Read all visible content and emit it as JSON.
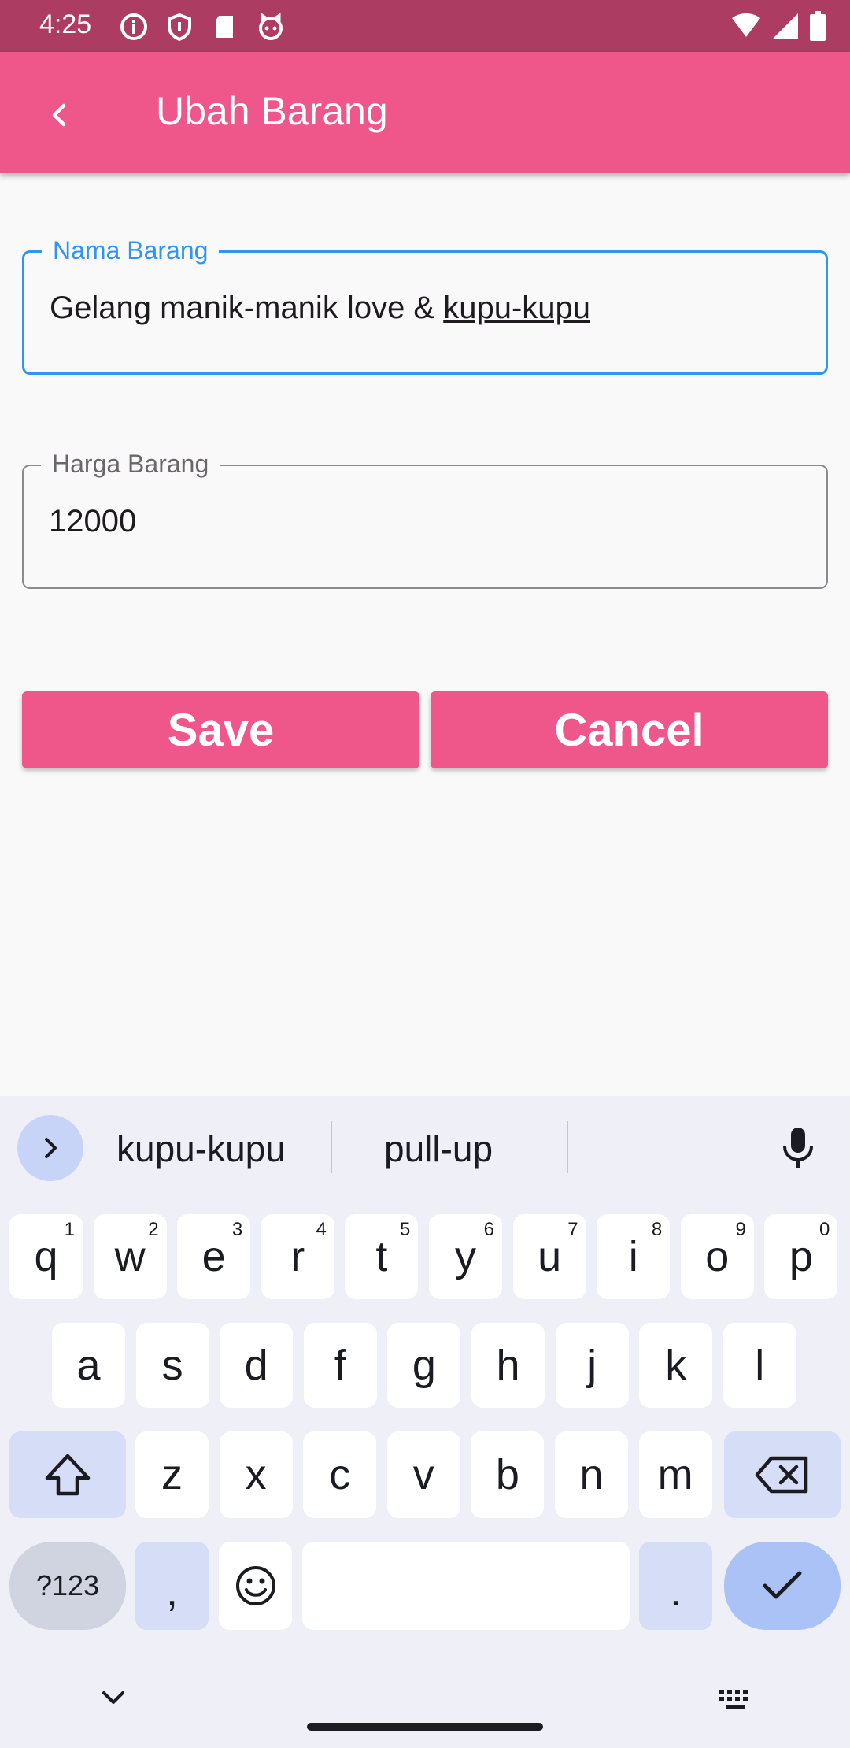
{
  "status_bar": {
    "time": "4:25",
    "left_icons": [
      "info-icon",
      "shield-icon",
      "sd-card-icon",
      "cat-face-icon"
    ],
    "right_icons": [
      "wifi-icon",
      "signal-icon",
      "battery-icon"
    ]
  },
  "app_bar": {
    "title": "Ubah Barang",
    "back_icon": "back-chevron-icon"
  },
  "form": {
    "name_field": {
      "label": "Nama Barang",
      "value_prefix": "Gelang manik-manik love & ",
      "value_underlined": "kupu-kupu"
    },
    "price_field": {
      "label": "Harga Barang",
      "value": "12000"
    },
    "save_label": "Save",
    "cancel_label": "Cancel"
  },
  "colors": {
    "app_bar": "#ef5689",
    "status_bar": "#ad3c63",
    "focus": "#2f95f0",
    "button": "#ef5689"
  },
  "keyboard": {
    "suggestions": [
      "kupu-kupu",
      "pull-up",
      ""
    ],
    "row1": [
      {
        "k": "q",
        "h": "1"
      },
      {
        "k": "w",
        "h": "2"
      },
      {
        "k": "e",
        "h": "3"
      },
      {
        "k": "r",
        "h": "4"
      },
      {
        "k": "t",
        "h": "5"
      },
      {
        "k": "y",
        "h": "6"
      },
      {
        "k": "u",
        "h": "7"
      },
      {
        "k": "i",
        "h": "8"
      },
      {
        "k": "o",
        "h": "9"
      },
      {
        "k": "p",
        "h": "0"
      }
    ],
    "row2": [
      "a",
      "s",
      "d",
      "f",
      "g",
      "h",
      "j",
      "k",
      "l"
    ],
    "row3": [
      "z",
      "x",
      "c",
      "v",
      "b",
      "n",
      "m"
    ],
    "symbols_label": "?123",
    "comma": ",",
    "period": "."
  }
}
